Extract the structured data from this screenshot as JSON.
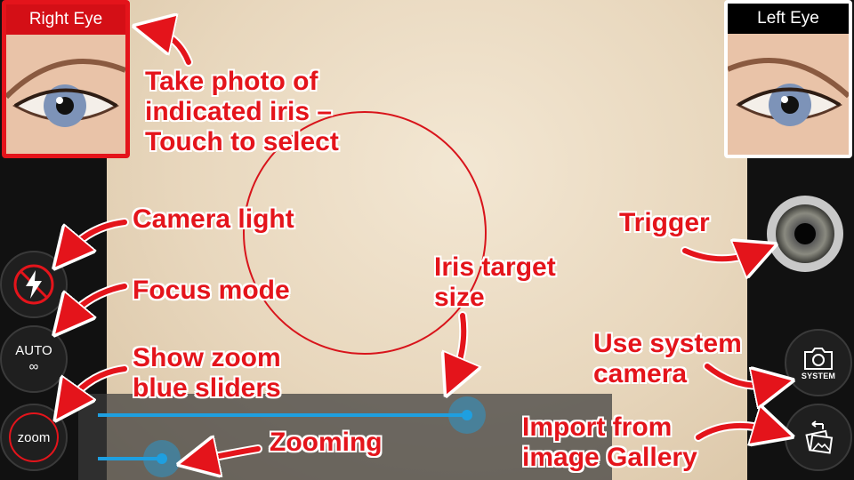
{
  "eyes": {
    "right": {
      "title": "Right Eye",
      "selected": true
    },
    "left": {
      "title": "Left Eye",
      "selected": false
    }
  },
  "controls": {
    "flash_icon": "flash-off-icon",
    "focus_mode": "AUTO",
    "focus_symbol": "∞",
    "zoom_label": "zoom",
    "system_label": "SYSTEM",
    "system_icon": "camera-icon",
    "gallery_icon": "gallery-import-icon",
    "trigger_icon": "iris-trigger-icon"
  },
  "sliders": {
    "target_size": 0.82,
    "zoom": 0.2
  },
  "annotations": {
    "take_photo": [
      "Take photo of",
      "indicated iris –",
      "Touch to select"
    ],
    "camera_light": "Camera light",
    "focus_mode": "Focus mode",
    "show_zoom": [
      "Show zoom",
      "blue sliders"
    ],
    "iris_target": [
      "Iris target",
      "size"
    ],
    "trigger": "Trigger",
    "use_system": [
      "Use system",
      "camera"
    ],
    "zooming": "Zooming",
    "import_gallery": [
      "Import from",
      "image Gallery"
    ]
  },
  "colors": {
    "accent_red": "#e4141b",
    "slider_blue": "#1e9fe0",
    "annotation_outline": "#ffffff"
  }
}
